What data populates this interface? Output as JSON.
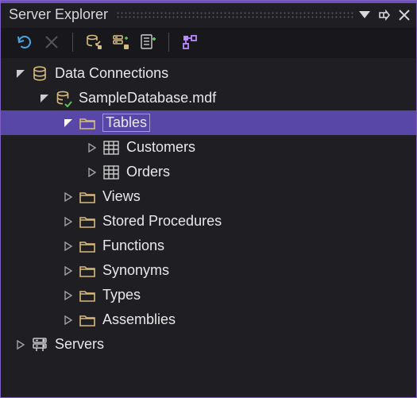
{
  "title": "Server Explorer",
  "toolbar": {
    "refresh": "Refresh",
    "stop": "Stop Refresh",
    "connectDb": "Connect to Database",
    "connectSrv": "Connect to Server",
    "services": "Services",
    "dataSources": "Show Data Sources"
  },
  "tree": {
    "data_connections": "Data Connections",
    "db": "SampleDatabase.mdf",
    "tables": "Tables",
    "customers": "Customers",
    "orders": "Orders",
    "views": "Views",
    "sp": "Stored Procedures",
    "functions": "Functions",
    "synonyms": "Synonyms",
    "types": "Types",
    "assemblies": "Assemblies",
    "servers": "Servers"
  },
  "colors": {
    "accent": "#6b4fbb",
    "selection": "#5847a6",
    "bg": "#1e1e23"
  }
}
